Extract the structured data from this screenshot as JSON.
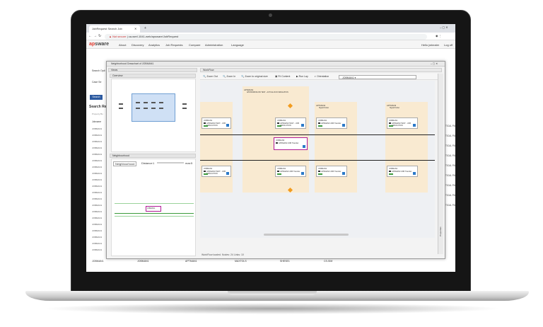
{
  "browser": {
    "tab_title": "JobRequest Search Job",
    "url_warning": "Not secure",
    "url": "ca-wmf-1041-web/apsware/JobRequest"
  },
  "app": {
    "logo_prefix": "ap",
    "logo_rest": "sware",
    "nav": [
      "About",
      "Discovery",
      "Analytics",
      "Job Requests",
      "Compare",
      "Administration",
      "Language"
    ],
    "user": "Hello jwhealer",
    "logout": "Log off"
  },
  "background_page": {
    "search_label": "Search Opti",
    "case_label": "Case Se",
    "search_button": "Search",
    "results_title": "Search Re",
    "property_filter": "Property Bo",
    "column_header": "Jobname",
    "rows": [
      "JOBMAN1",
      "JOBMAN1",
      "JOBMAN1",
      "JOBMAN1",
      "JOBMAN1",
      "JOBMAN1",
      "JOBMAN1",
      "JOBMAN1",
      "JOBMAN1",
      "JOBMAN1",
      "JOBMAN1",
      "JOBMAN1",
      "JOBMAN1",
      "JOBMAN1",
      "JOBMAN1",
      "JOBMAN1",
      "JOBMAN1",
      "JOBMAN1",
      "JOBMAN1",
      "JOBMAN1"
    ],
    "path_col": [
      "TICAL PATH",
      "TICAL PATH",
      "TICAL PATH",
      "TICAL PATH",
      "TICAL PATH",
      "TICAL PATH",
      "TICAL PATH",
      "TICAL PATH",
      "TICAL PATH"
    ],
    "bottom_row": [
      "JOBMAN1",
      "JOBMAN1",
      "APTMAN1",
      "MAXTOLS",
      "SHESE1",
      "CS-SIM"
    ]
  },
  "dialog": {
    "title": "Neighborhood Drawchart of JOBMAN1",
    "views_header": "Views",
    "overview_header": "Overview",
    "neighbourhood_header": "Neighbourhood",
    "neighbourhood_select": "Neighbourhood",
    "distance_label": "Distance",
    "distance_value": "1",
    "max_label": "max",
    "max_value": "5",
    "workflow_header": "WorkFlow",
    "toolbar": [
      "Zoom Out",
      "Zoom In",
      "Zoom to original size",
      "Fit Content",
      "Run Lay",
      "Orientation"
    ],
    "workflow_select": "JOBMAN1",
    "status": "WorkFlow loaded. Nodes: 24 Links: 10",
    "properties_label": "Properties"
  },
  "workflow": {
    "lanes": [
      {
        "id": "APSMAN1",
        "desc": "APS/WORKFLOW TEST - ACTUAL RUN SIMULATION"
      },
      {
        "id": "APTMAN2",
        "desc": "Signal Finder"
      },
      {
        "id": "APTMAN3",
        "desc": "Signal Finder"
      }
    ],
    "nodes": [
      {
        "id": "JOBMAN1",
        "desc": "APSMAN0 TEST - JOB SIMULATION"
      },
      {
        "id": "JOBMAN1",
        "desc": "APSMAN0 TEST - JOB SIMULATION"
      },
      {
        "id": "JOBMAN3",
        "desc": "APSMAN0 JOB Transfer"
      },
      {
        "id": "JOBMAN1",
        "desc": "APSMAN0 JOB Transfer"
      },
      {
        "id": "JOBMAN1",
        "desc": "APSMAN0 TEST - JOB SIMULATION"
      },
      {
        "id": "JOBMAN1",
        "desc": "APSMAN0 TEST - JOB SIMULATION"
      },
      {
        "id": "JOBMAN1",
        "desc": "APSMAN0 JOB Transfer"
      },
      {
        "id": "JOBMAN1",
        "desc": "APSMAN0 JOB Transfer"
      },
      {
        "id": "JOBMAN1",
        "desc": "APSMAN0 JOB Transfer"
      }
    ],
    "neighbour_selected": "JOBMAN1"
  },
  "colors": {
    "lane": "#f9ead1",
    "highlight": "#b01b96",
    "accent": "#2c5aa0",
    "diamond": "#f29c1f"
  }
}
